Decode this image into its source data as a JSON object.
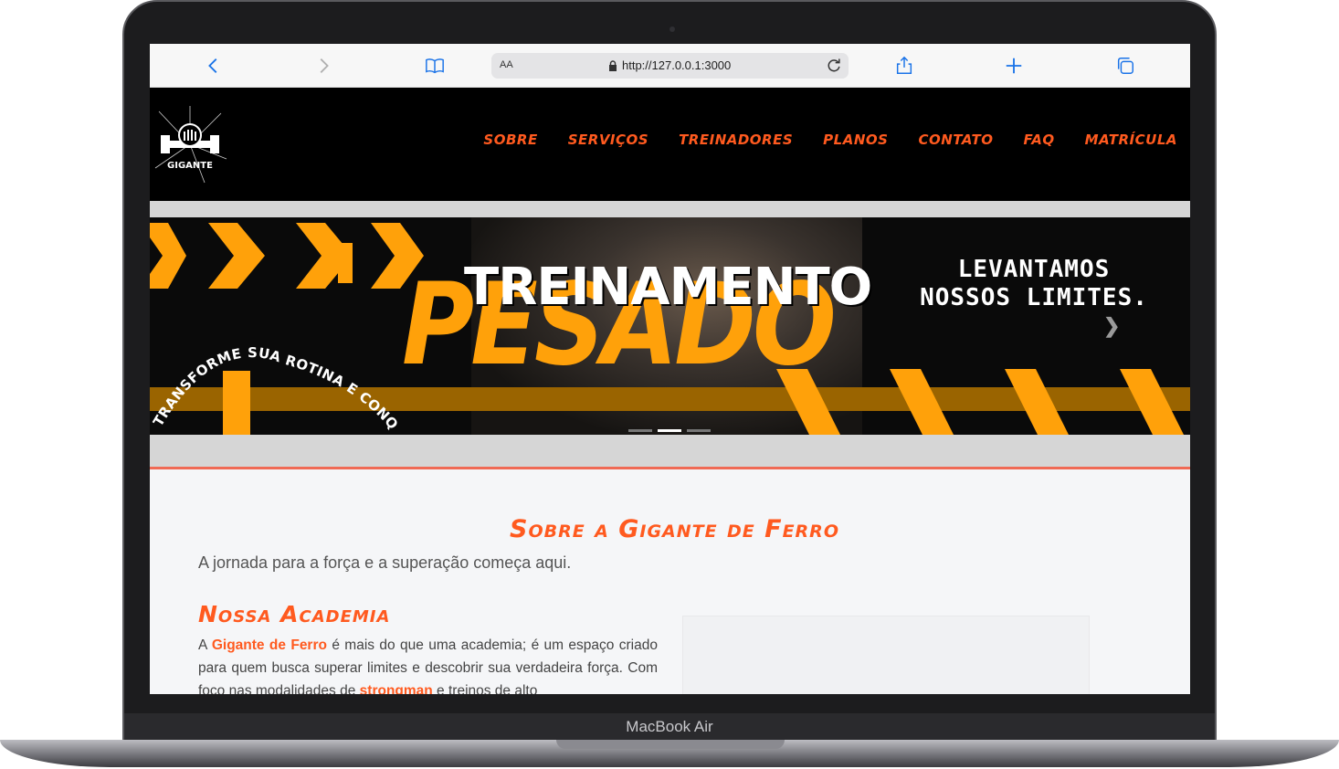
{
  "device": {
    "brand_label": "MacBook Air"
  },
  "browser": {
    "address_aa": "AA",
    "url": "http://127.0.0.1:3000"
  },
  "site": {
    "logo_text": "GIGANTE",
    "nav": [
      "Sobre",
      "Serviços",
      "Treinadores",
      "Planos",
      "Contato",
      "FAQ",
      "Matrícula"
    ],
    "colors": {
      "accent": "#ff5a1f",
      "banner_orange": "#ffa10a"
    }
  },
  "banner": {
    "word_big": "PESADO",
    "word_overlay": "TREINAMENTO",
    "slogan_line1": "LEVANTAMOS",
    "slogan_line2": "NOSSOS LIMITES.",
    "arc_text": "TRANSFORME SUA ROTINA E CONQUISTE",
    "slides": 3,
    "active_slide": 2
  },
  "about": {
    "title": "Sobre a Gigante de Ferro",
    "subtitle": "A jornada para a força e a superação começa aqui.",
    "academy_title": "Nossa Academia",
    "text_a": "A ",
    "text_highlight1": "Gigante de Ferro",
    "text_b": " é mais do que uma academia; é um espaço criado para quem busca superar limites e descobrir sua verdadeira força. Com foco nas modalidades de ",
    "text_highlight2": "strongman",
    "text_c": " e treinos de alto"
  }
}
